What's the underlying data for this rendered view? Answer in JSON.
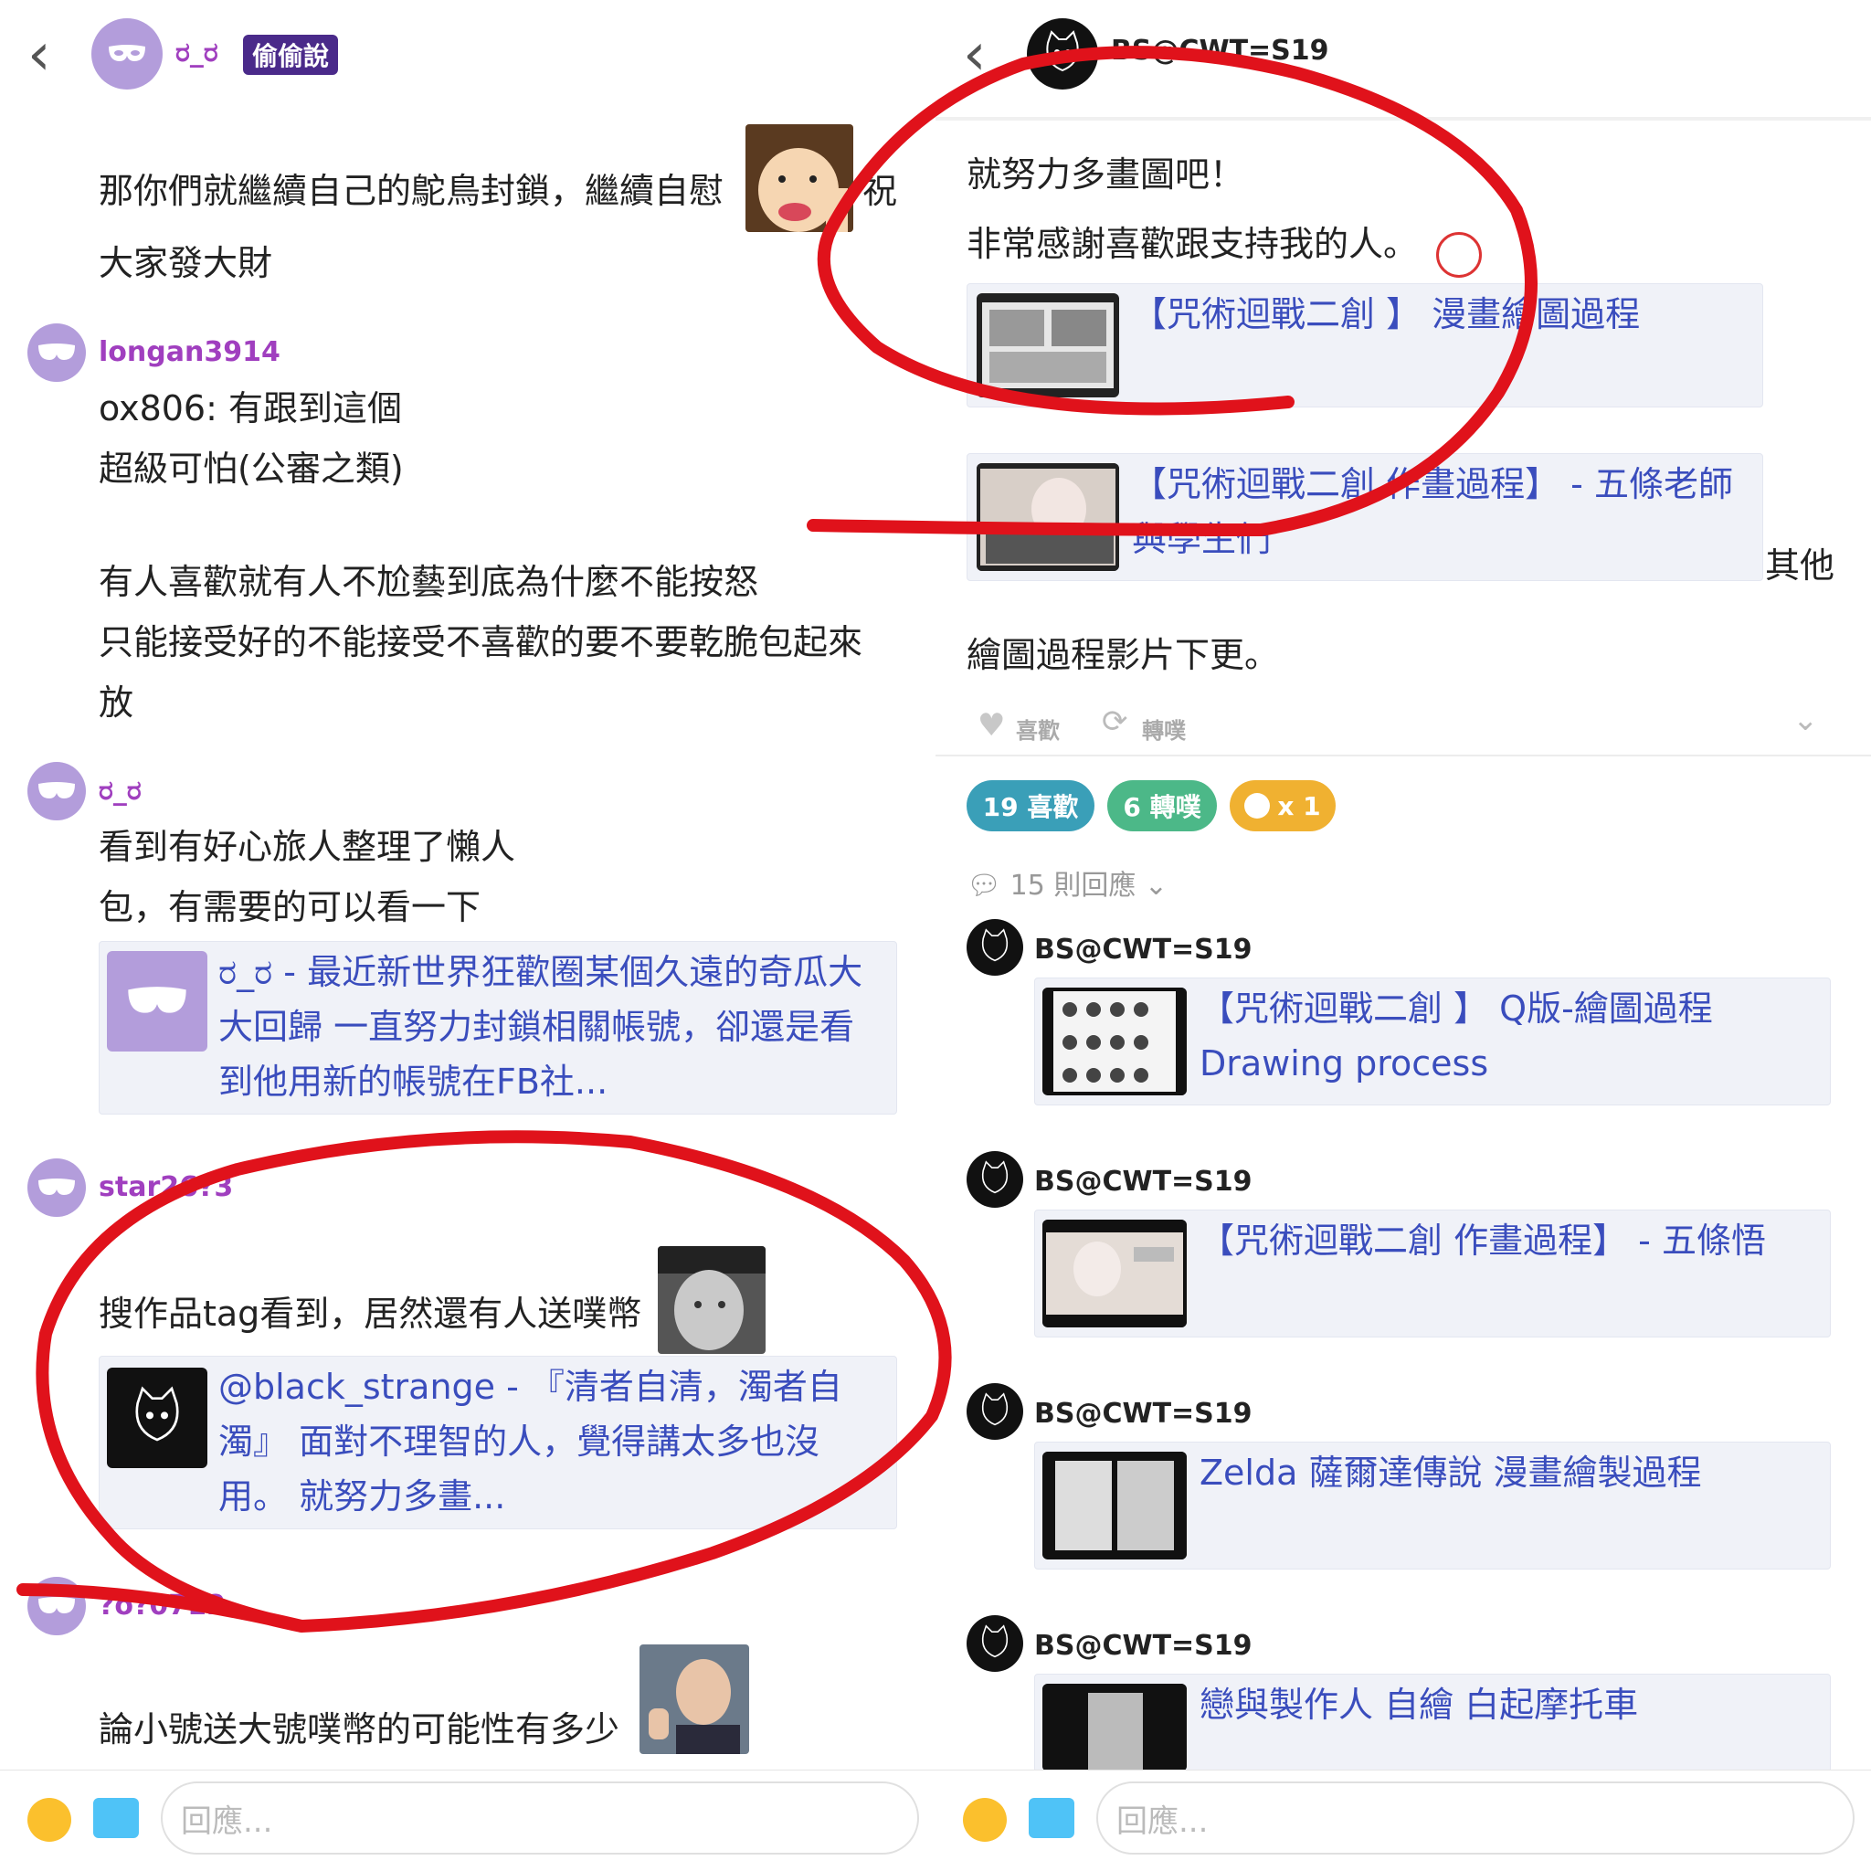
{
  "left": {
    "header": {
      "username": "ರ_ರ",
      "badge": "偷偷說"
    },
    "post": {
      "line1": "那你們就繼續自己的鴕鳥封鎖，繼續自慰",
      "line1_tail": "祝",
      "line2": "大家發大財"
    },
    "comments": [
      {
        "user": "longan3914",
        "lines": [
          "ox806: 有跟到這個",
          "超級可怕(公審之類)",
          "",
          "有人喜歡就有人不尬藝到底為什麼不能按怒",
          "只能接受好的不能接受不喜歡的要不要乾脆包起來",
          "放"
        ]
      },
      {
        "user": "ರ_ರ",
        "lines": [
          "看到有好心旅人整理了懶人",
          "包，有需要的可以看一下"
        ],
        "card": {
          "lines": [
            "ರ_ರ - 最近新世界狂歡圈某個久遠的奇瓜大",
            "大回歸 一直努力封鎖相關帳號，卻還是看",
            "到他用新的帳號在FB社..."
          ]
        }
      },
      {
        "user": "star26?3",
        "lines": [
          "搜作品tag看到，居然還有人送噗幣"
        ],
        "card": {
          "lines": [
            "@black_strange - 『清者自清，濁者自",
            "濁』 面對不理智的人，覺得講太多也沒",
            "用。 就努力多畫..."
          ]
        }
      },
      {
        "user": "?o?0712",
        "lines": [
          "論小號送大號噗幣的可能性有多少"
        ]
      }
    ],
    "reply_placeholder": "回應..."
  },
  "right": {
    "header": {
      "username": "BS@CWT=S19"
    },
    "post": {
      "line1": "就努力多畫圖吧！",
      "line2": "非常感謝喜歡跟支持我的人。",
      "card1": "【咒術迴戰二創 】 漫畫繪圖過程",
      "card2_lines": [
        "【咒術迴戰二創 作畫過程】 - 五條老師",
        "與學生們"
      ],
      "aside": "其他",
      "line3": "繪圖過程影片下更。"
    },
    "actions": {
      "like": "喜歡",
      "replurk": "轉噗"
    },
    "stats": {
      "likes": "19 喜歡",
      "replurks": "6 轉噗",
      "coins": "x 1"
    },
    "responses_label": "15 則回應",
    "responses": [
      {
        "user": "BS@CWT=S19",
        "card_lines": [
          "【咒術迴戰二創 】 Q版-繪圖過程",
          "Drawing process"
        ]
      },
      {
        "user": "BS@CWT=S19",
        "card_lines": [
          "【咒術迴戰二創 作畫過程】 - 五條悟"
        ]
      },
      {
        "user": "BS@CWT=S19",
        "card_lines": [
          "Zelda 薩爾達傳說 漫畫繪製過程"
        ]
      },
      {
        "user": "BS@CWT=S19",
        "card_lines": [
          "戀與製作人 自繪 白起摩托車"
        ]
      }
    ],
    "reply_placeholder": "回應..."
  },
  "colors": {
    "username_purple": "#a03fbf",
    "link_blue": "#3a4dbd",
    "badge_purple": "#4a2a8a",
    "like_pill": "#3a9fb8",
    "replurk_pill": "#4cb888",
    "coin_pill": "#f0b131",
    "annotation_red": "#e0121b"
  }
}
